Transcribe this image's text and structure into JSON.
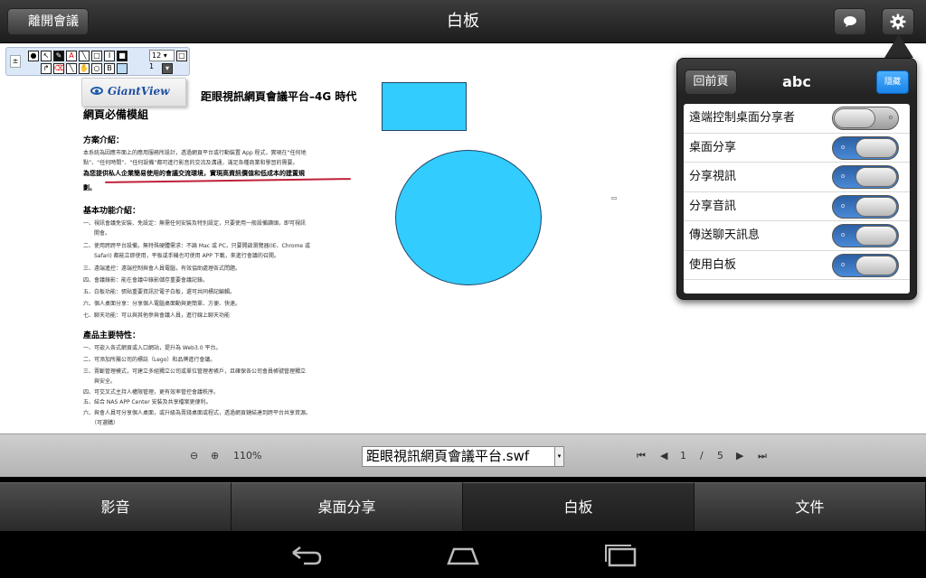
{
  "header": {
    "back_label": "離開會議",
    "title": "白板",
    "chat_icon": "chat-bubble-icon",
    "settings_icon": "gear-icon"
  },
  "toolbox": {
    "font_size": "12",
    "line_width": "1"
  },
  "document": {
    "logo_text": "GiantView",
    "title_line1": "距眼視訊網頁會議平台–4G 時代",
    "title_line2": "網頁必備模組",
    "section1_heading": "方案介紹：",
    "section1_lines": [
      "本系統為因應市面上的應用服務所設計，透過網頁平台或行動裝置 App 程式，實現在“任何地",
      "點”、“任何時間”、“任何設備”都可進行影音的交流及溝通，滿足各種商業和學習的需要。"
    ],
    "section1_bold": [
      "為您提供私人企業簡易使用的會議交流環境，實現高資訊價值和低成本的建置規",
      "劃。"
    ],
    "section2_heading": "基本功能介紹：",
    "section2_lines": [
      "一、視訊會議免安裝、免設定：無需任何安裝及特別設定，只要使用一般設備讀頭，即可視訊",
      "　　開會。",
      "二、使用跨跨平台設備，無特殊硬體需求：不論 Mac 或 PC，只要開啟瀏覽器(IE、Chrome 或",
      "　　Safari) 都能立即使用，平板或手機也可使用 APP 下載，來進行會議的召開。",
      "三、遠端遙控：遠端控制與會人員電腦，有效協助處理各式問題。",
      "四、會議錄影：能在會議中錄影儲存重要會議記錄。",
      "五、白板功能：張貼重要資訊於電子白板，還可共同標記編輯。",
      "六、個人桌面分享：分享個人電腦桌面動與更簡單、方便、快速。",
      "七、聊天功能：可以與其他參與會議人員，進行線上聊天功能"
    ],
    "section3_heading": "產品主要特性：",
    "section3_lines": [
      "一、可嵌入各式網頁或入口網站，提升為 Web3.0 平台。",
      "二、可添加所屬公司的標誌（Lego）和品牌進行會議。",
      "三、賣斷管理模式，可建立多組獨立公司或單位管理者帳戶，且確保各公司會員帳號管理獨立",
      "　　與安全。",
      "四、可交叉式主持人權限管理，更有效率管控會議秩序。",
      "五、結合 NAS APP Center 安裝及共享檔案更便利。",
      "六、與會人員可分享個人桌面，或升級為賣錢桌面或程式，透過網頁鏈結達到跨平台共享資源。",
      "　　（可選購）"
    ]
  },
  "settings_popover": {
    "back_label": "回前頁",
    "title": "abc",
    "hide_label": "隱藏",
    "rows": [
      {
        "label": "遠端控制桌面分享者",
        "state": "off"
      },
      {
        "label": "桌面分享",
        "state": "on"
      },
      {
        "label": "分享視訊",
        "state": "on"
      },
      {
        "label": "分享音訊",
        "state": "on"
      },
      {
        "label": "傳送聊天訊息",
        "state": "on"
      },
      {
        "label": "使用白板",
        "state": "on"
      }
    ]
  },
  "controls": {
    "zoom_level": "110%",
    "file_name": "距眼視訊網頁會議平台.swf",
    "current_page": "1",
    "page_separator": "/",
    "total_pages": "5"
  },
  "tabs": [
    {
      "label": "影音",
      "active": false
    },
    {
      "label": "桌面分享",
      "active": false
    },
    {
      "label": "白板",
      "active": true
    },
    {
      "label": "文件",
      "active": false
    }
  ],
  "colors": {
    "shape_fill": "#33ccff",
    "hide_button": "#1a84e8",
    "toggle_on": "#2c5fa3",
    "underline": "#c0203a"
  }
}
